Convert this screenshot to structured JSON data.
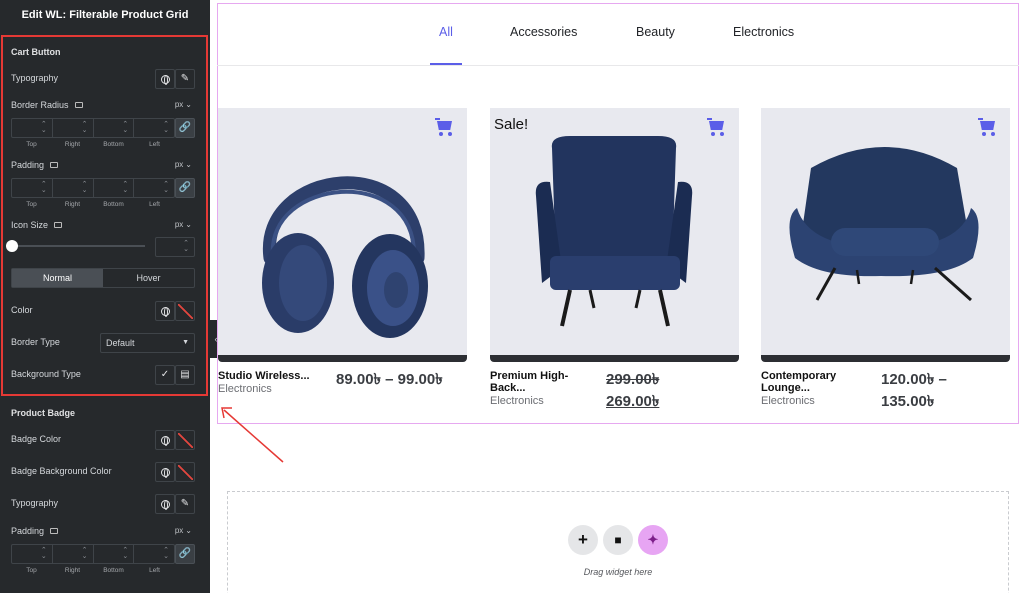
{
  "editor": {
    "title": "Edit WL: Filterable Product Grid",
    "cart_button": {
      "section_title": "Cart Button",
      "typography_label": "Typography",
      "border_radius_label": "Border Radius",
      "border_radius_unit": "px",
      "dim_labels": [
        "Top",
        "Right",
        "Bottom",
        "Left"
      ],
      "padding_label": "Padding",
      "padding_unit": "px",
      "icon_size_label": "Icon Size",
      "icon_size_unit": "px",
      "tab_normal": "Normal",
      "tab_hover": "Hover",
      "color_label": "Color",
      "border_type_label": "Border Type",
      "border_type_value": "Default",
      "background_type_label": "Background Type"
    },
    "product_badge": {
      "section_title": "Product Badge",
      "badge_color_label": "Badge Color",
      "badge_bg_label": "Badge Background Color",
      "typography_label": "Typography",
      "padding_label": "Padding",
      "padding_unit": "px",
      "dim_labels": [
        "Top",
        "Right",
        "Bottom",
        "Left"
      ]
    },
    "accent_color": "#e53935"
  },
  "filters": [
    "All",
    "Accessories",
    "Beauty",
    "Electronics"
  ],
  "active_filter": "All",
  "products": [
    {
      "name": "Studio Wireless...",
      "category": "Electronics",
      "price": "89.00৳ – 99.00৳",
      "badge": ""
    },
    {
      "name": "Premium High-Back...",
      "name_line1": "Premium High-",
      "name_line2": "Back...",
      "category": "Electronics",
      "old_price": "299.00৳",
      "price": "269.00৳",
      "badge": "Sale!"
    },
    {
      "name": "Contemporary Lounge...",
      "name_line1": "Contemporary",
      "name_line2": "Lounge...",
      "category": "Electronics",
      "price_line1": "120.00৳ –",
      "price_line2": "135.00৳",
      "badge": ""
    }
  ],
  "dropzone": {
    "text": "Drag widget here",
    "add_icon": "plus-icon",
    "folder_icon": "folder-icon",
    "ai_icon": "sparkle-icon"
  },
  "colors": {
    "brand": "#5b5ee8",
    "sidebar_bg": "#26292c",
    "card_bg": "#e8e9ef",
    "frame_border": "#e6a8f0"
  }
}
